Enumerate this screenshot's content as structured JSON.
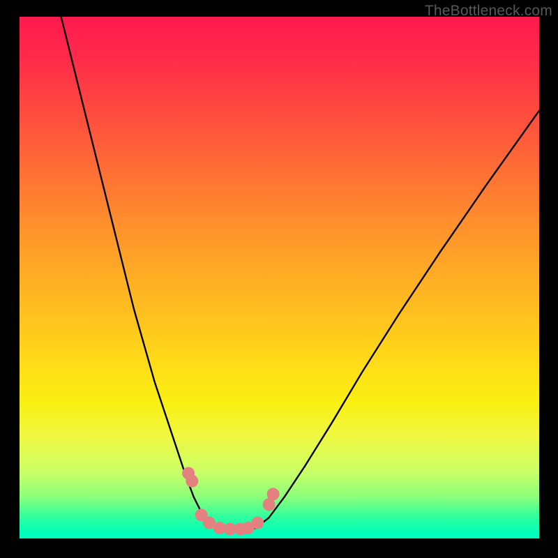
{
  "watermark": "TheBottleneck.com",
  "colors": {
    "curve_stroke": "#000000",
    "marker_fill": "#e48080",
    "marker_stroke": "#d06868",
    "background_black": "#000000"
  },
  "chart_data": {
    "type": "line",
    "title": "",
    "xlabel": "",
    "ylabel": "",
    "xlim": [
      0,
      100
    ],
    "ylim": [
      0,
      100
    ],
    "grid": false,
    "legend": false,
    "series": [
      {
        "name": "left-curve",
        "x": [
          8,
          10,
          12,
          14,
          16,
          18,
          20,
          22,
          24,
          26,
          28,
          30,
          32,
          33.5,
          35,
          36,
          37,
          38
        ],
        "y": [
          100,
          92,
          84,
          76,
          68,
          60,
          52,
          44,
          37,
          30,
          24,
          18,
          12,
          8,
          5,
          3.5,
          2.5,
          2
        ]
      },
      {
        "name": "floor-segment",
        "x": [
          38,
          40,
          42,
          44,
          45.5
        ],
        "y": [
          2,
          1.8,
          1.8,
          1.8,
          2
        ]
      },
      {
        "name": "right-curve",
        "x": [
          45.5,
          48,
          51,
          55,
          60,
          66,
          73,
          81,
          90,
          100
        ],
        "y": [
          2,
          4,
          8,
          14,
          22,
          32,
          43,
          55,
          68,
          82
        ]
      }
    ],
    "markers": {
      "name": "highlight-points",
      "points": [
        {
          "x": 32.5,
          "y": 12.5
        },
        {
          "x": 33.2,
          "y": 11
        },
        {
          "x": 35.0,
          "y": 4.5
        },
        {
          "x": 36.5,
          "y": 3.0
        },
        {
          "x": 38.5,
          "y": 2.0
        },
        {
          "x": 40.5,
          "y": 1.8
        },
        {
          "x": 42.5,
          "y": 1.8
        },
        {
          "x": 44.0,
          "y": 2.0
        },
        {
          "x": 45.8,
          "y": 3.0
        },
        {
          "x": 48.0,
          "y": 6.5
        },
        {
          "x": 48.8,
          "y": 8.5
        }
      ],
      "radius_px": 9
    }
  }
}
